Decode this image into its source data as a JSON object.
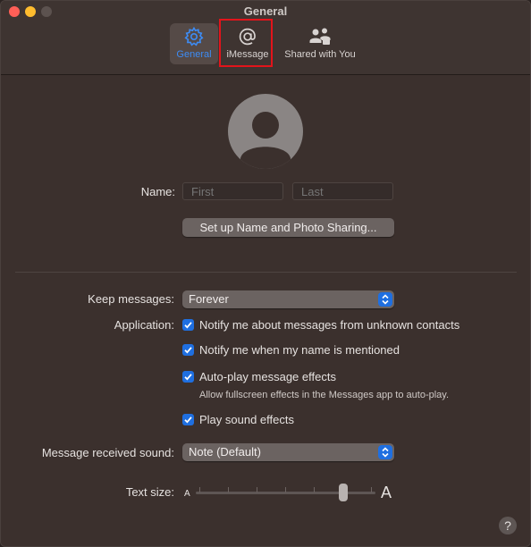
{
  "window": {
    "title": "General"
  },
  "toolbar": {
    "tabs": [
      {
        "label": "General",
        "icon": "gear-icon",
        "selected": true
      },
      {
        "label": "iMessage",
        "icon": "at-sign-icon",
        "selected": false
      },
      {
        "label": "Shared with You",
        "icon": "shared-people-icon",
        "selected": false
      }
    ]
  },
  "profile": {
    "name_label": "Name:",
    "first_placeholder": "First",
    "last_placeholder": "Last",
    "setup_button": "Set up Name and Photo Sharing..."
  },
  "settings": {
    "keep_messages_label": "Keep messages:",
    "keep_messages_value": "Forever",
    "application_label": "Application:",
    "options": [
      {
        "label": "Notify me about messages from unknown contacts",
        "checked": true
      },
      {
        "label": "Notify me when my name is mentioned",
        "checked": true
      },
      {
        "label": "Auto-play message effects",
        "checked": true,
        "sublabel": "Allow fullscreen effects in the Messages app to auto-play."
      },
      {
        "label": "Play sound effects",
        "checked": true
      }
    ],
    "sound_label": "Message received sound:",
    "sound_value": "Note (Default)",
    "text_size_label": "Text size:",
    "text_size_small": "A",
    "text_size_large": "A",
    "text_size_steps": 7,
    "text_size_level": 6
  },
  "help": {
    "label": "?"
  },
  "colors": {
    "accent": "#1f6fe0",
    "selected_tab_label": "#3d8cf5",
    "highlight_box": "#e2141b"
  }
}
